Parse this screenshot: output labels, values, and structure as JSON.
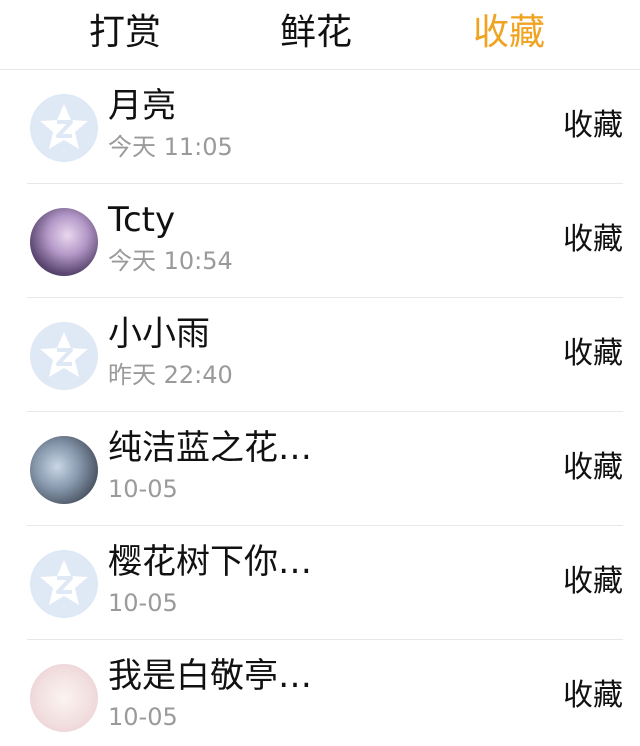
{
  "tabs": [
    {
      "label": "打赏"
    },
    {
      "label": "鲜花"
    },
    {
      "label": "收藏"
    }
  ],
  "colors": {
    "active_tab": "#f0a321",
    "secondary_text": "#9a9a9a",
    "default_avatar": "#dfe8f5"
  },
  "items": [
    {
      "name": "月亮",
      "time": "今天 11:05",
      "action": "收藏",
      "avatar": "default-qq-avatar-icon"
    },
    {
      "name": "Tcty",
      "time": "今天 10:54",
      "action": "收藏",
      "avatar": "user-photo"
    },
    {
      "name": "小小雨",
      "time": "昨天 22:40",
      "action": "收藏",
      "avatar": "default-qq-avatar-icon"
    },
    {
      "name": "纯洁蓝之花…",
      "time": "10-05",
      "action": "收藏",
      "avatar": "user-photo"
    },
    {
      "name": "樱花树下你…",
      "time": "10-05",
      "action": "收藏",
      "avatar": "default-qq-avatar-icon"
    },
    {
      "name": "我是白敬亭…",
      "time": "10-05",
      "action": "收藏",
      "avatar": "user-photo"
    }
  ]
}
